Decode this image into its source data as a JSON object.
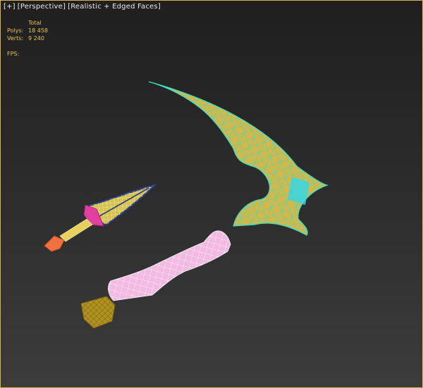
{
  "viewport": {
    "menu_plus": "[+]",
    "view_mode": "[Perspective]",
    "shading_mode": "[Realistic + Edged Faces]"
  },
  "stats": {
    "header": "Total",
    "polys_label": "Polys:",
    "polys_value": "18 458",
    "verts_label": "Verts:",
    "verts_value": "9 240",
    "fps_label": "FPS:"
  },
  "colors": {
    "border": "#d9b34a",
    "blade_fill": "#d2b84a",
    "blade_wire": "#36e0c8",
    "handle_fill": "#f2b9e1",
    "handle_wire": "#ffffff",
    "pommel_fill": "#b0901f",
    "dagger_blade_edge": "#2c3e8c",
    "dagger_guard": "#e040a0",
    "dagger_tip": "#f07040"
  }
}
